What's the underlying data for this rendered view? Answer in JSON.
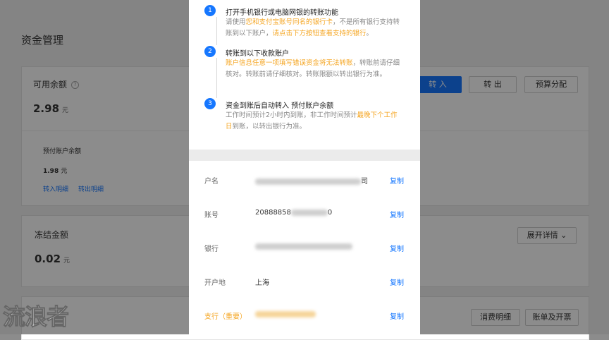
{
  "page": {
    "title": "资金管理",
    "available": {
      "label": "可用余额",
      "help_icon": "question-circle-icon",
      "amount": "2.98",
      "unit": "元",
      "btn_in": "转 入",
      "btn_out": "转 出",
      "btn_budget": "预算分配",
      "prepaid_label": "预付账户余额",
      "prepaid_amount": "1.98",
      "prepaid_unit": "元",
      "link_in": "转入明细",
      "link_out": "转出明细"
    },
    "frozen": {
      "label": "冻结金额",
      "amount": "0.02",
      "unit": "元",
      "btn_expand": "展开详情",
      "expand_icon": "chevron-down-icon"
    },
    "bottom": {
      "btn_consume": "消费明细",
      "btn_bill": "账单及开票"
    }
  },
  "modal": {
    "steps": [
      {
        "num": "1",
        "title": "打开手机银行或电脑网银的转账功能",
        "desc_parts": [
          {
            "t": "请使用",
            "h": false
          },
          {
            "t": "您和支付宝账号同名的银行卡",
            "h": true
          },
          {
            "t": "，不是所有银行支持转账到以下账户，",
            "h": false
          },
          {
            "t": "请点击下方按钮查看支持的银行",
            "h": true
          },
          {
            "t": "。",
            "h": false
          }
        ]
      },
      {
        "num": "2",
        "title": "转账到以下收款账户",
        "desc_parts": [
          {
            "t": "账户信息任意一项填写错误资金将无法转账",
            "h": true
          },
          {
            "t": "，转账前请仔细核对。转账前请仔细核对。转账限额以转出银行为准。",
            "h": false
          }
        ]
      },
      {
        "num": "3",
        "title": "资金到账后自动转入 预付账户余额",
        "desc_parts": [
          {
            "t": "工作时间预计2小时内到账，非工作时间预计",
            "h": false
          },
          {
            "t": "最晚下个工作日",
            "h": true
          },
          {
            "t": "到账，以转出银行为准。",
            "h": false
          }
        ]
      }
    ],
    "rows": [
      {
        "label": "户名",
        "value": "",
        "value_tail": "司",
        "copy": "复制",
        "highlight": false
      },
      {
        "label": "账号",
        "value": "20888858",
        "value_tail": "0",
        "copy": "复制",
        "highlight": false
      },
      {
        "label": "银行",
        "value": "",
        "value_tail": "",
        "copy": "复制",
        "highlight": false
      },
      {
        "label": "开户地",
        "value": "上海",
        "value_tail": "",
        "copy": "复制",
        "highlight": false
      },
      {
        "label": "支行（重要）",
        "value": "",
        "value_tail": "",
        "copy": "复制",
        "highlight": true
      }
    ]
  },
  "watermark": "流浪者",
  "colors": {
    "accent": "#1677ff",
    "highlight": "#f5a623"
  }
}
